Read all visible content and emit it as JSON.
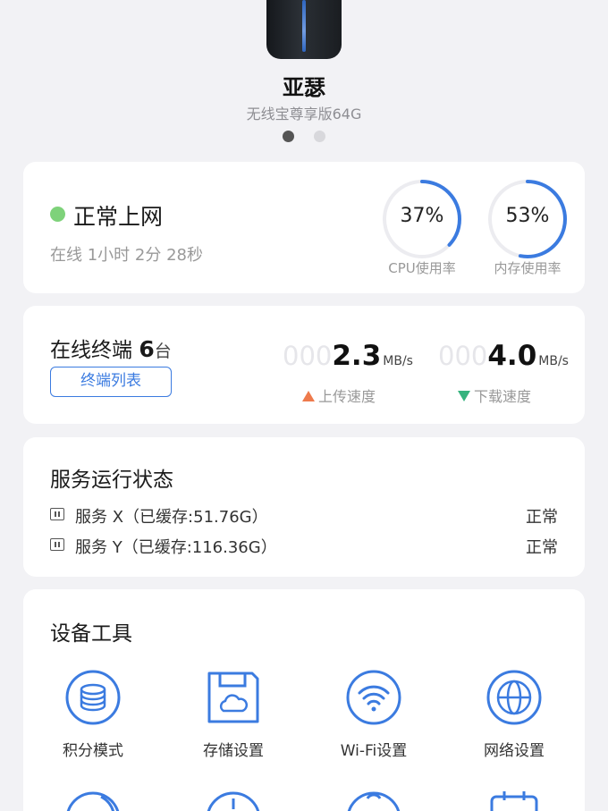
{
  "device": {
    "name": "亚瑟",
    "model": "无线宝尊享版64G",
    "pages": 2,
    "active_page": 1
  },
  "status": {
    "title": "正常上网",
    "uptime": "在线 1小时 2分 28秒",
    "online_color": "#7ed27a",
    "cpu": {
      "value": 37,
      "text": "37%",
      "label": "CPU使用率"
    },
    "memory": {
      "value": 53,
      "text": "53%",
      "label": "内存使用率"
    }
  },
  "terminals": {
    "title": "在线终端",
    "count": "6",
    "unit": "台",
    "button": "终端列表",
    "upload": {
      "pad": "000",
      "value": "2.3",
      "unit": "MB/s",
      "label": "上传速度"
    },
    "download": {
      "pad": "000",
      "value": "4.0",
      "unit": "MB/s",
      "label": "下载速度"
    }
  },
  "services": {
    "title": "服务运行状态",
    "items": [
      {
        "name": "服务 X（已缓存:51.76G）",
        "status": "正常"
      },
      {
        "name": "服务 Y（已缓存:116.36G）",
        "status": "正常"
      }
    ]
  },
  "tools": {
    "title": "设备工具",
    "items": [
      {
        "label": "积分模式",
        "icon": "coin-stack-icon"
      },
      {
        "label": "存储设置",
        "icon": "storage-icon"
      },
      {
        "label": "Wi-Fi设置",
        "icon": "wifi-icon"
      },
      {
        "label": "网络设置",
        "icon": "globe-icon"
      }
    ]
  },
  "colors": {
    "accent": "#3b7be0",
    "gauge_track": "#ececf0",
    "upload": "#ee7a4c",
    "download": "#36b37e"
  }
}
